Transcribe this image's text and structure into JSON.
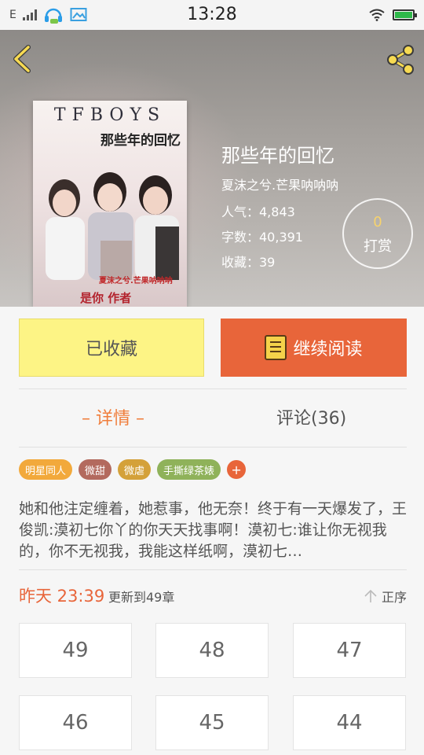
{
  "status_bar": {
    "carrier": "E",
    "time": "13:28",
    "battery_color": "#2fb84a"
  },
  "header": {
    "back_icon": "chevron-left-icon",
    "share_icon": "share-icon"
  },
  "book": {
    "cover": {
      "brand": "TFBOYS",
      "title": "那些年的回忆",
      "author": "夏沫之兮.芒果呐呐呐",
      "slogan": "是你  作者"
    },
    "title": "那些年的回忆",
    "author": "夏沫之兮.芒果呐呐呐",
    "popularity": "人气：4,843",
    "word_count": "字数：40,391",
    "favorites": "收藏：39",
    "tip": {
      "count": "0",
      "label": "打赏"
    }
  },
  "actions": {
    "collected_label": "已收藏",
    "continue_label": "继续阅读",
    "accent_color": "#e8653a",
    "collected_color": "#fdf485"
  },
  "tabs": {
    "details": "– 详情 –",
    "comments": "评论(36)"
  },
  "tags": [
    {
      "label": "明星同人",
      "color": "#f2a93b"
    },
    {
      "label": "微甜",
      "color": "#b36a5e"
    },
    {
      "label": "微虐",
      "color": "#d4a13a"
    },
    {
      "label": "手撕绿茶婊",
      "color": "#8fb25a"
    }
  ],
  "tag_add_label": "+",
  "synopsis": "她和他注定缠着，她惹事，他无奈！终于有一天爆发了，王俊凯:漠初七你丫的你天天找事啊！漠初七:谁让你无视我的，你不无视我，我能这样纸啊，漠初七…",
  "update": {
    "time": "昨天 23:39",
    "chapter": "更新到49章",
    "sort_label": "正序"
  },
  "chapters": [
    "49",
    "48",
    "47",
    "46",
    "45",
    "44"
  ]
}
